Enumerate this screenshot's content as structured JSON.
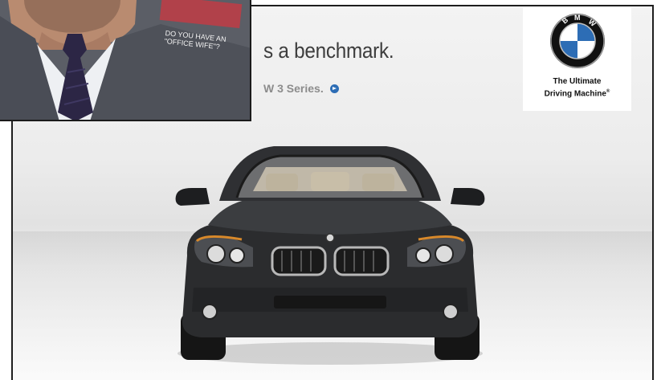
{
  "ad": {
    "headline": "s a benchmark.",
    "sublink": "W 3 Series.",
    "logo": {
      "letters": "BMW",
      "tagline_line1": "The Ultimate",
      "tagline_line2": "Driving Machine",
      "trademark": "®"
    }
  },
  "inset": {
    "cover_text_line1": "DO YOU HAVE AN",
    "cover_text_line2": "\"OFFICE WIFE\"?"
  },
  "colors": {
    "brand_blue": "#2d6db5",
    "frame_border": "#1e1e1e",
    "headline": "#3d3d3d"
  }
}
